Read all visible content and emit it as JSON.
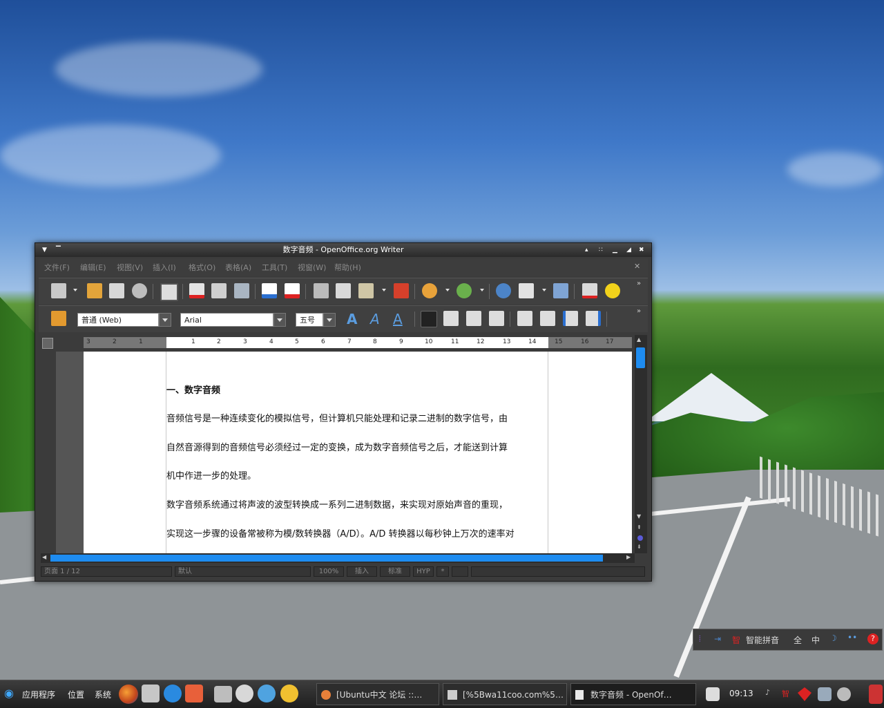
{
  "window": {
    "title": "数字音频 - OpenOffice.org Writer"
  },
  "menu": [
    "文件(F)",
    "编辑(E)",
    "视图(V)",
    "插入(I)",
    "格式(O)",
    "表格(A)",
    "工具(T)",
    "视窗(W)",
    "帮助(H)"
  ],
  "format": {
    "style": "普通 (Web)",
    "font": "Arial",
    "size": "五号"
  },
  "ruler": {
    "labels": [
      "3",
      "2",
      "1",
      "1",
      "2",
      "3",
      "4",
      "5",
      "6",
      "7",
      "8",
      "9",
      "10",
      "11",
      "12",
      "13",
      "14",
      "15",
      "16",
      "17"
    ]
  },
  "document": {
    "heading": "一、数字音频",
    "lines": [
      "音频信号是一种连续变化的模拟信号，但计算机只能处理和记录二进制的数字信号，由",
      "自然音源得到的音频信号必须经过一定的变换，成为数字音频信号之后，才能送到计算",
      "机中作进一步的处理。",
      "数字音频系统通过将声波的波型转换成一系列二进制数据，来实现对原始声音的重现，",
      "实现这一步骤的设备常被称为模/数转换器（A/D）。A/D 转换器以每秒钟上万次的速率对"
    ]
  },
  "status": {
    "page": "页面 1 / 12",
    "style": "默认",
    "zoom": "100%",
    "insert": "插入",
    "std": "标准",
    "hyp": "HYP",
    "mod": "*"
  },
  "ime": {
    "name": "智能拼音",
    "full": "全",
    "zh": "中"
  },
  "taskbar": {
    "apps": "应用程序",
    "places": "位置",
    "system": "系统",
    "tasks": [
      "[Ubuntu中文 论坛 ::…",
      "[%5Bwa11coo.com%5…",
      "数字音频 - OpenOf…"
    ],
    "clock": "09:13"
  },
  "colors": {
    "window_bg": "#3b3b3b",
    "selection_blue": "#1e8cf0"
  }
}
